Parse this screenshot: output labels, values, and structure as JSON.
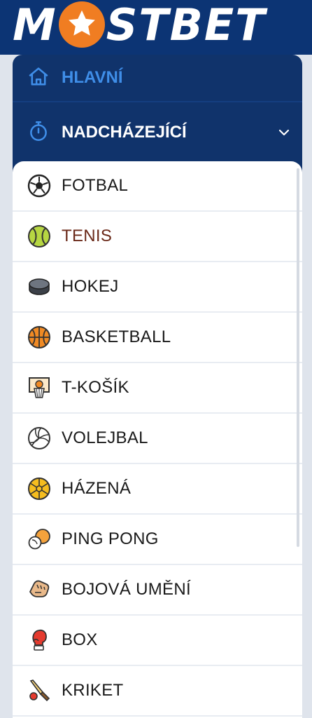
{
  "brand": {
    "logo_left": "M",
    "logo_right": "STBET",
    "star_color": "#f07d22"
  },
  "nav": {
    "home_label": "HLAVNÍ",
    "upcoming_label": "NADCHÁZEJÍCÍ"
  },
  "sports": [
    {
      "label": "FOTBAL",
      "icon": "soccer-ball-icon"
    },
    {
      "label": "TENIS",
      "icon": "tennis-ball-icon"
    },
    {
      "label": "HOKEJ",
      "icon": "hockey-puck-icon"
    },
    {
      "label": "BASKETBALL",
      "icon": "basketball-icon"
    },
    {
      "label": "T-KOŠÍK",
      "icon": "basketball-hoop-icon"
    },
    {
      "label": "VOLEJBAL",
      "icon": "volleyball-icon"
    },
    {
      "label": "HÁZENÁ",
      "icon": "handball-icon"
    },
    {
      "label": "PING PONG",
      "icon": "ping-pong-icon"
    },
    {
      "label": "BOJOVÁ UMĚNÍ",
      "icon": "martial-arts-fist-icon"
    },
    {
      "label": "BOX",
      "icon": "boxing-glove-icon"
    },
    {
      "label": "KRIKET",
      "icon": "cricket-bat-icon"
    }
  ],
  "colors": {
    "header": "#0c3474",
    "nav": "#10336b",
    "accent": "#3f8ee8",
    "active_item": "#6b2a1a"
  }
}
